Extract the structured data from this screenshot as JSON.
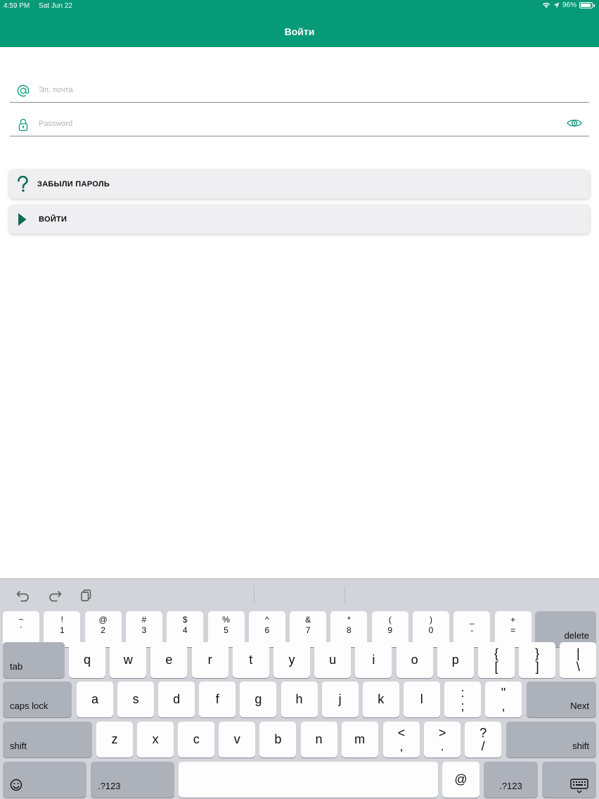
{
  "status_bar": {
    "time": "4:59 PM",
    "date": "Sat Jun 22",
    "battery": "96%"
  },
  "header": {
    "title": "Войти"
  },
  "form": {
    "email": {
      "placeholder": "Эл. почта",
      "value": ""
    },
    "password": {
      "placeholder": "Password",
      "value": ""
    }
  },
  "actions": {
    "forgot_label": "ЗАБЫЛИ ПАРОЛЬ",
    "login_label": "ВОЙТИ"
  },
  "colors": {
    "brand": "#079a78",
    "icon_dark": "#0f6e55"
  },
  "keyboard": {
    "row1": [
      {
        "top": "~",
        "bot": "`"
      },
      {
        "top": "!",
        "bot": "1"
      },
      {
        "top": "@",
        "bot": "2"
      },
      {
        "top": "#",
        "bot": "3"
      },
      {
        "top": "$",
        "bot": "4"
      },
      {
        "top": "%",
        "bot": "5"
      },
      {
        "top": "^",
        "bot": "6"
      },
      {
        "top": "&",
        "bot": "7"
      },
      {
        "top": "*",
        "bot": "8"
      },
      {
        "top": "(",
        "bot": "9"
      },
      {
        "top": ")",
        "bot": "0"
      },
      {
        "top": "_",
        "bot": "-"
      },
      {
        "top": "+",
        "bot": "="
      }
    ],
    "delete": "delete",
    "tab": "tab",
    "row2": [
      "q",
      "w",
      "e",
      "r",
      "t",
      "y",
      "u",
      "i",
      "o",
      "p"
    ],
    "row2_sym": [
      {
        "top": "{",
        "bot": "["
      },
      {
        "top": "}",
        "bot": "]"
      },
      {
        "top": "|",
        "bot": "\\"
      }
    ],
    "caps_lock": "caps lock",
    "row3": [
      "a",
      "s",
      "d",
      "f",
      "g",
      "h",
      "j",
      "k",
      "l"
    ],
    "row3_sym": [
      {
        "top": ":",
        "bot": ";"
      },
      {
        "top": "\"",
        "bot": ","
      }
    ],
    "next": "Next",
    "shift": "shift",
    "row4": [
      "z",
      "x",
      "c",
      "v",
      "b",
      "n",
      "m"
    ],
    "row4_sym": [
      {
        "top": "<",
        "bot": ","
      },
      {
        "top": ">",
        "bot": "."
      },
      {
        "top": "?",
        "bot": "/"
      }
    ],
    "numbers": ".?123",
    "at": "@"
  }
}
